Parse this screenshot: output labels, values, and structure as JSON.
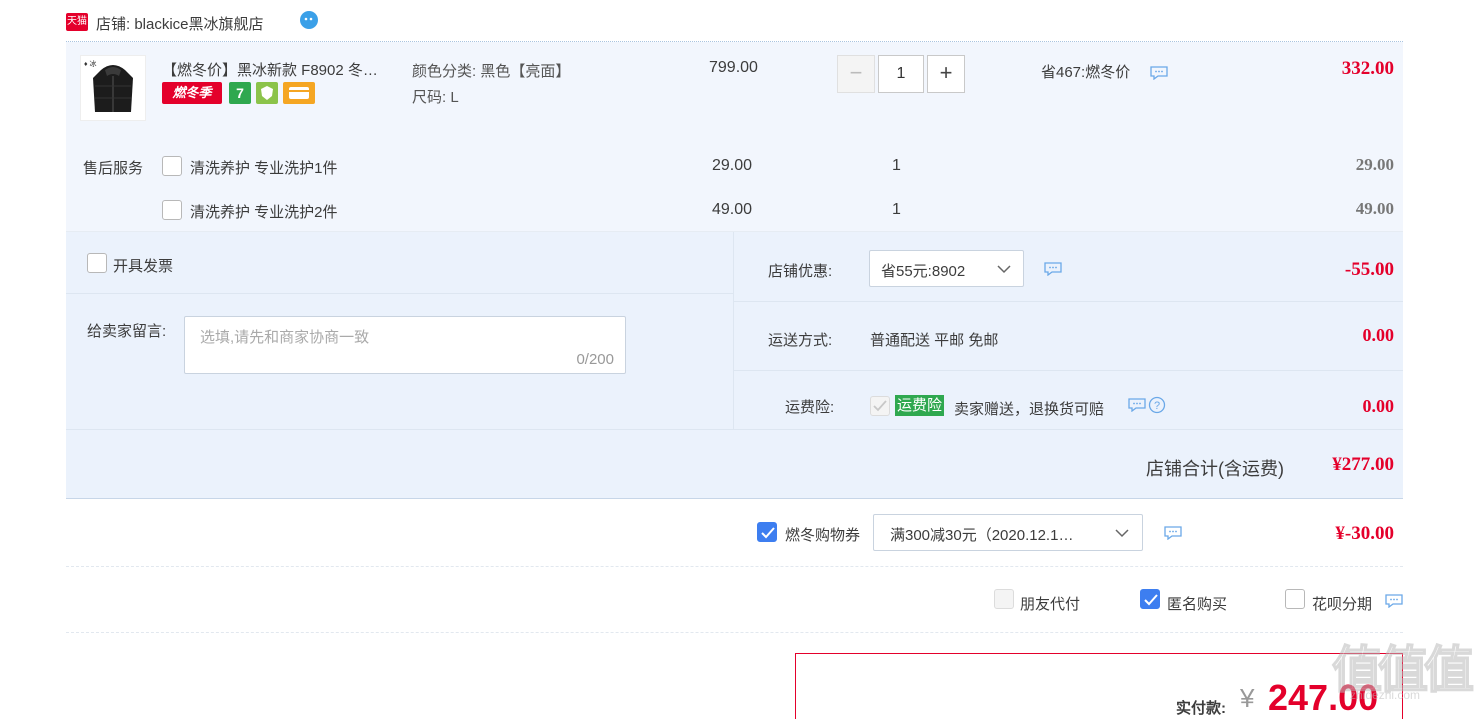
{
  "shop": {
    "badge": "天猫",
    "name": "店铺: blackice黑冰旗舰店"
  },
  "item": {
    "title": "【燃冬价】黑冰新款 F8902 冬…",
    "promo_tag": "燃冬季",
    "tag_seven": "7",
    "sku_color": "颜色分类: 黑色【亮面】",
    "sku_size": "尺码: L",
    "price": "799.00",
    "qty": "1",
    "saving": "省467:燃冬价",
    "subtotal": "332.00"
  },
  "after_sale": {
    "label": "售后服务",
    "options": [
      {
        "name": "清洗养护 专业洗护1件",
        "price": "29.00",
        "qty": "1",
        "total": "29.00"
      },
      {
        "name": "清洗养护 专业洗护2件",
        "price": "49.00",
        "qty": "1",
        "total": "49.00"
      }
    ]
  },
  "invoice": {
    "label": "开具发票"
  },
  "message": {
    "label": "给卖家留言:",
    "placeholder": "选填,请先和商家协商一致",
    "counter": "0/200"
  },
  "shop_discount": {
    "label": "店铺优惠:",
    "selected": "省55元:8902",
    "amount": "-55.00"
  },
  "shipping": {
    "label": "运送方式:",
    "value": "普通配送 平邮 免邮",
    "amount": "0.00"
  },
  "insurance": {
    "label": "运费险:",
    "badge": "运费险",
    "text": "卖家赠送，退换货可赔",
    "amount": "0.00"
  },
  "shop_total": {
    "label": "店铺合计(含运费)",
    "amount": "¥277.00"
  },
  "coupon": {
    "label": "燃冬购物券",
    "selected": "满300减30元（2020.12.1…",
    "amount": "¥-30.00"
  },
  "pay_options": [
    {
      "label": "朋友代付",
      "state": "disabled"
    },
    {
      "label": "匿名购买",
      "state": "checked"
    },
    {
      "label": "花呗分期",
      "state": "unchecked"
    }
  ],
  "payment": {
    "label": "实付款:",
    "currency": "¥",
    "amount": "247.00"
  },
  "watermark": {
    "main": "值",
    "sub": "zhidezhi.com"
  },
  "colors": {
    "accent_red": "#e4002b",
    "checkbox_blue": "#3d7ef0",
    "band_bg": "#f2f6fd",
    "insurance_green": "#2fa84f"
  }
}
